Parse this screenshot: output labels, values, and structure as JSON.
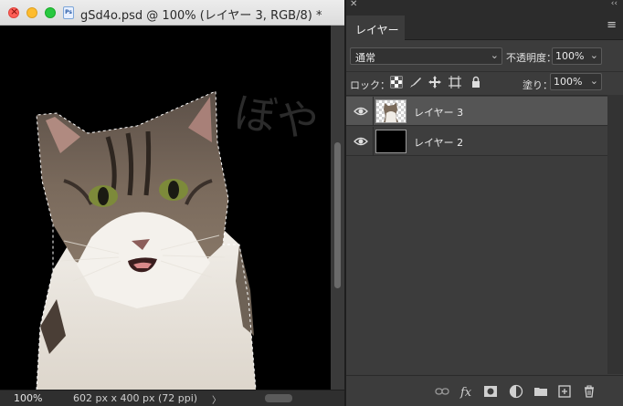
{
  "document": {
    "title": "gSd4o.psd @ 100% (レイヤー 3, RGB/8) *",
    "file_icon_text": "Ps",
    "canvas_text": "ぼや"
  },
  "status": {
    "zoom": "100%",
    "info": "602 px x 400 px (72 ppi)",
    "arrow": "〉"
  },
  "panel": {
    "tab": "レイヤー",
    "blend_mode": "通常",
    "opacity_label": "不透明度：",
    "opacity_value": "100%",
    "lock_label": "ロック：",
    "fill_label": "塗り：",
    "fill_value": "100%",
    "layers": [
      {
        "name": "レイヤー 3",
        "visible": true,
        "selected": true
      },
      {
        "name": "レイヤー 2",
        "visible": true,
        "selected": false
      }
    ]
  },
  "colors": {
    "close": "#ff5f57",
    "minimize": "#febc2e",
    "maximize": "#28c840",
    "selected_row": "#555555",
    "panel_bg": "#3c3c3c"
  }
}
